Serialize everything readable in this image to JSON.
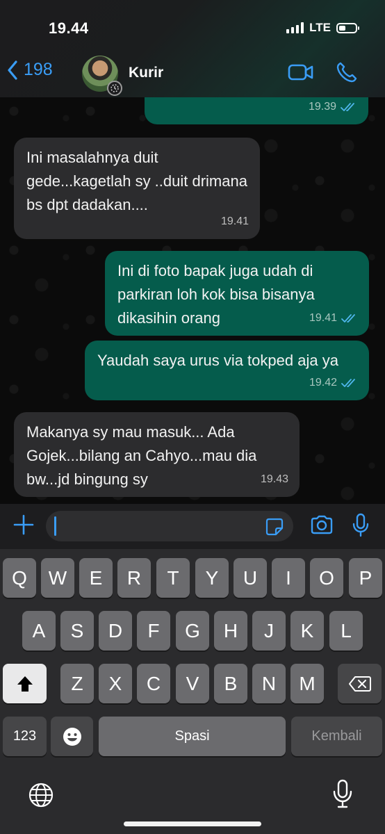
{
  "status_bar": {
    "time": "19.44",
    "network": "LTE"
  },
  "header": {
    "back_count": "198",
    "contact_name": "Kurir",
    "accent_color": "#3a9df6"
  },
  "messages": [
    {
      "direction": "out",
      "text": "",
      "time": "19.39",
      "read": true
    },
    {
      "direction": "in",
      "text": "Ini masalahnya duit gede...kagetlah sy ..duit drimana bs dpt dadakan....",
      "time": "19.41"
    },
    {
      "direction": "out",
      "text": "Ini di foto bapak juga udah di parkiran loh kok bisa bisanya dikasihin orang",
      "time": "19.41",
      "read": true
    },
    {
      "direction": "out",
      "text": "Yaudah saya urus via tokped aja ya",
      "time": "19.42",
      "read": true
    },
    {
      "direction": "in",
      "text": "Makanya sy mau masuk... Ada Gojek...bilang an Cahyo...mau dia bw...jd bingung sy",
      "time": "19.43"
    }
  ],
  "input": {
    "placeholder": ""
  },
  "keyboard": {
    "row1": [
      "Q",
      "W",
      "E",
      "R",
      "T",
      "Y",
      "U",
      "I",
      "O",
      "P"
    ],
    "row2": [
      "A",
      "S",
      "D",
      "F",
      "G",
      "H",
      "J",
      "K",
      "L"
    ],
    "row3": [
      "Z",
      "X",
      "C",
      "V",
      "B",
      "N",
      "M"
    ],
    "numbers_key": "123",
    "space_key": "Spasi",
    "return_key": "Kembali"
  },
  "icons": [
    "back-chevron-icon",
    "video-call-icon",
    "phone-call-icon",
    "plus-icon",
    "sticker-icon",
    "camera-icon",
    "microphone-icon",
    "shift-icon",
    "backspace-icon",
    "emoji-icon",
    "globe-icon",
    "dictation-icon",
    "read-receipt-icon"
  ]
}
